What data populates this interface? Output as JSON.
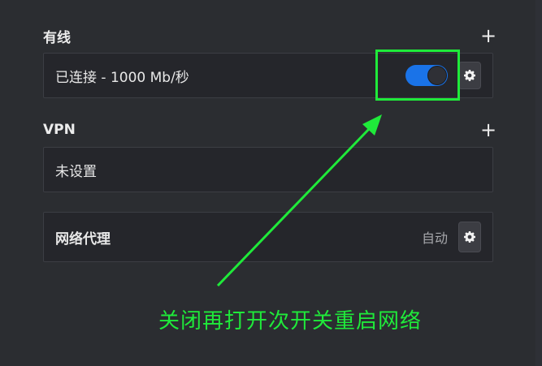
{
  "wired": {
    "title": "有线",
    "add_icon": "plus-icon",
    "status": "已连接 - 1000 Mb/秒",
    "toggle_on": true,
    "settings_icon": "gear-icon"
  },
  "vpn": {
    "title": "VPN",
    "add_icon": "plus-icon",
    "status": "未设置"
  },
  "proxy": {
    "title": "网络代理",
    "value": "自动",
    "settings_icon": "gear-icon"
  },
  "annotation": {
    "text": "关闭再打开次开关重启网络",
    "color": "#1fea3a"
  },
  "colors": {
    "background": "#2b2d31",
    "row_background": "#25262b",
    "toggle_on": "#1a73e8",
    "annotation": "#1fea3a"
  }
}
